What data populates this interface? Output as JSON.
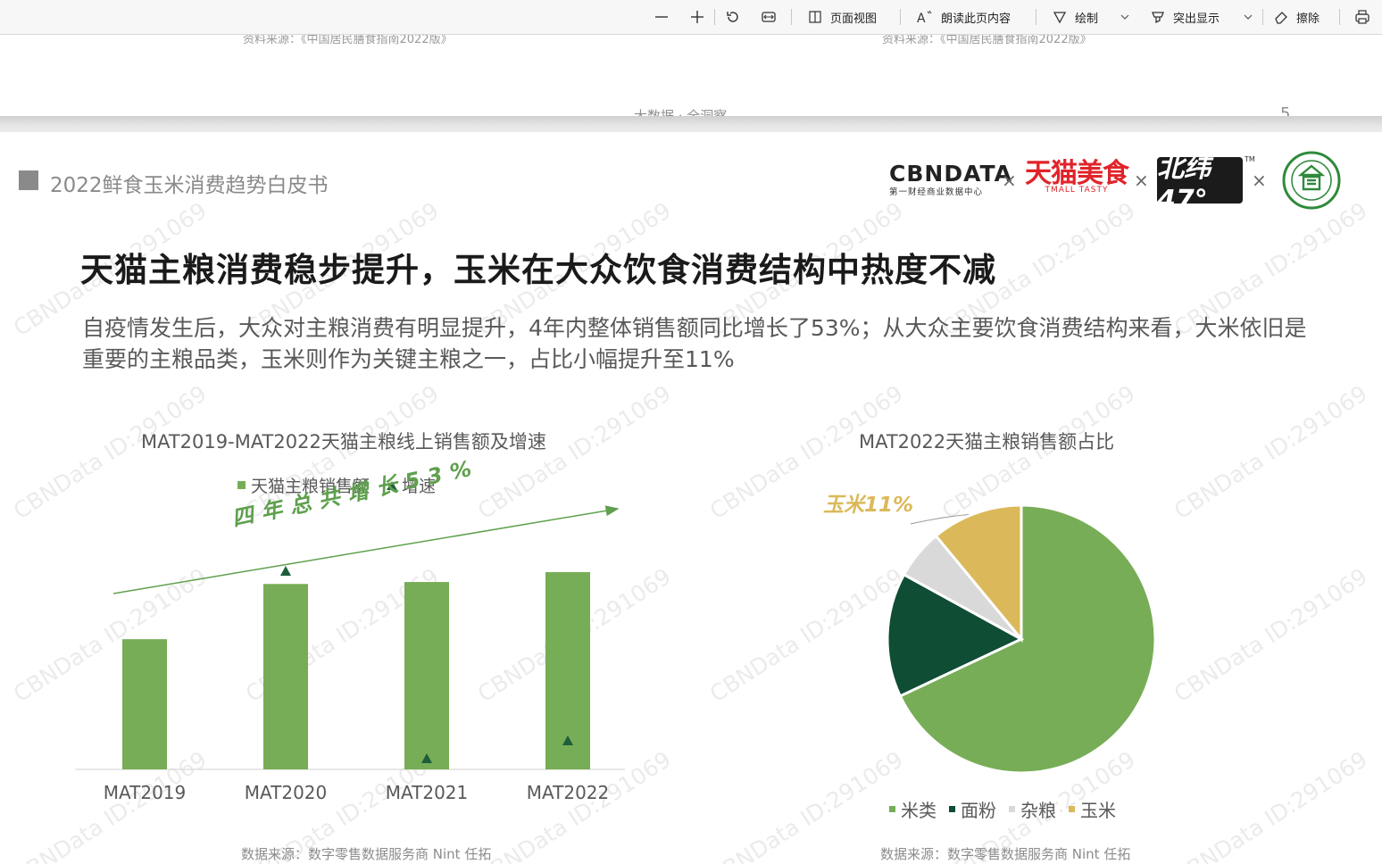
{
  "toolbar": {
    "zoom_out": "−",
    "zoom_in": "+",
    "page_view": "页面视图",
    "read_aloud": "朗读此页内容",
    "draw": "绘制",
    "highlight": "突出显示",
    "erase": "擦除"
  },
  "prev_page": {
    "source_left": "资料来源：《中国居民膳食指南2022版》",
    "source_right": "资料来源：《中国居民膳食指南2022版》",
    "footer": "大数据 · 全洞察",
    "page_number": "5"
  },
  "slide": {
    "header": "2022鲜食玉米消费趋势白皮书",
    "logos": {
      "cbn_main": "CBNDATA",
      "cbn_sub": "第一财经商业数据中心",
      "tmall_main": "天猫美食",
      "tmall_sub": "TMALL TASTY",
      "beiwei": "北纬47°",
      "tm": "TM",
      "times": "×"
    },
    "title": "天猫主粮消费稳步提升，玉米在大众饮食消费结构中热度不减",
    "subtitle": "自疫情发生后，大众对主粮消费有明显提升，4年内整体销售额同比增长了53%；从大众主要饮食消费结构来看，大米依旧是重要的主粮品类，玉米则作为关键主粮之一，占比小幅提升至11%",
    "watermark": "CBNData ID:291069",
    "bar_chart": {
      "title": "MAT2019-MAT2022天猫主粮线上销售额及增速",
      "legend_sales": "天猫主粮销售额",
      "legend_growth": "增速",
      "annotation": "四年总共增长53%",
      "source": "数据来源：数字零售数据服务商 Nint 任拓"
    },
    "pie_chart": {
      "title": "MAT2022天猫主粮销售额占比",
      "corn_label": "玉米11%",
      "source": "数据来源：数字零售数据服务商 Nint 任拓"
    }
  },
  "colors": {
    "bar_green": "#77ad56",
    "growth_marker": "#1d5e3c",
    "rice": "#77ad56",
    "flour": "#0f4d34",
    "grains": "#d9d9d9",
    "corn": "#dbb95a"
  },
  "chart_data": [
    {
      "type": "bar",
      "title": "MAT2019-MAT2022天猫主粮线上销售额及增速",
      "categories": [
        "MAT2019",
        "MAT2020",
        "MAT2021",
        "MAT2022"
      ],
      "series": [
        {
          "name": "天猫主粮销售额",
          "values": [
            0.66,
            0.94,
            0.95,
            1.0
          ]
        },
        {
          "name": "增速",
          "values": [
            null,
            1.07,
            0.02,
            0.12
          ]
        }
      ],
      "ylim": [
        0,
        1.1
      ],
      "legend": "top-center",
      "grid": false
    },
    {
      "type": "pie",
      "title": "MAT2022天猫主粮销售额占比",
      "categories": [
        "米类",
        "面粉",
        "杂粮",
        "玉米"
      ],
      "values": [
        68,
        15,
        6,
        11
      ],
      "legend": "bottom"
    }
  ]
}
